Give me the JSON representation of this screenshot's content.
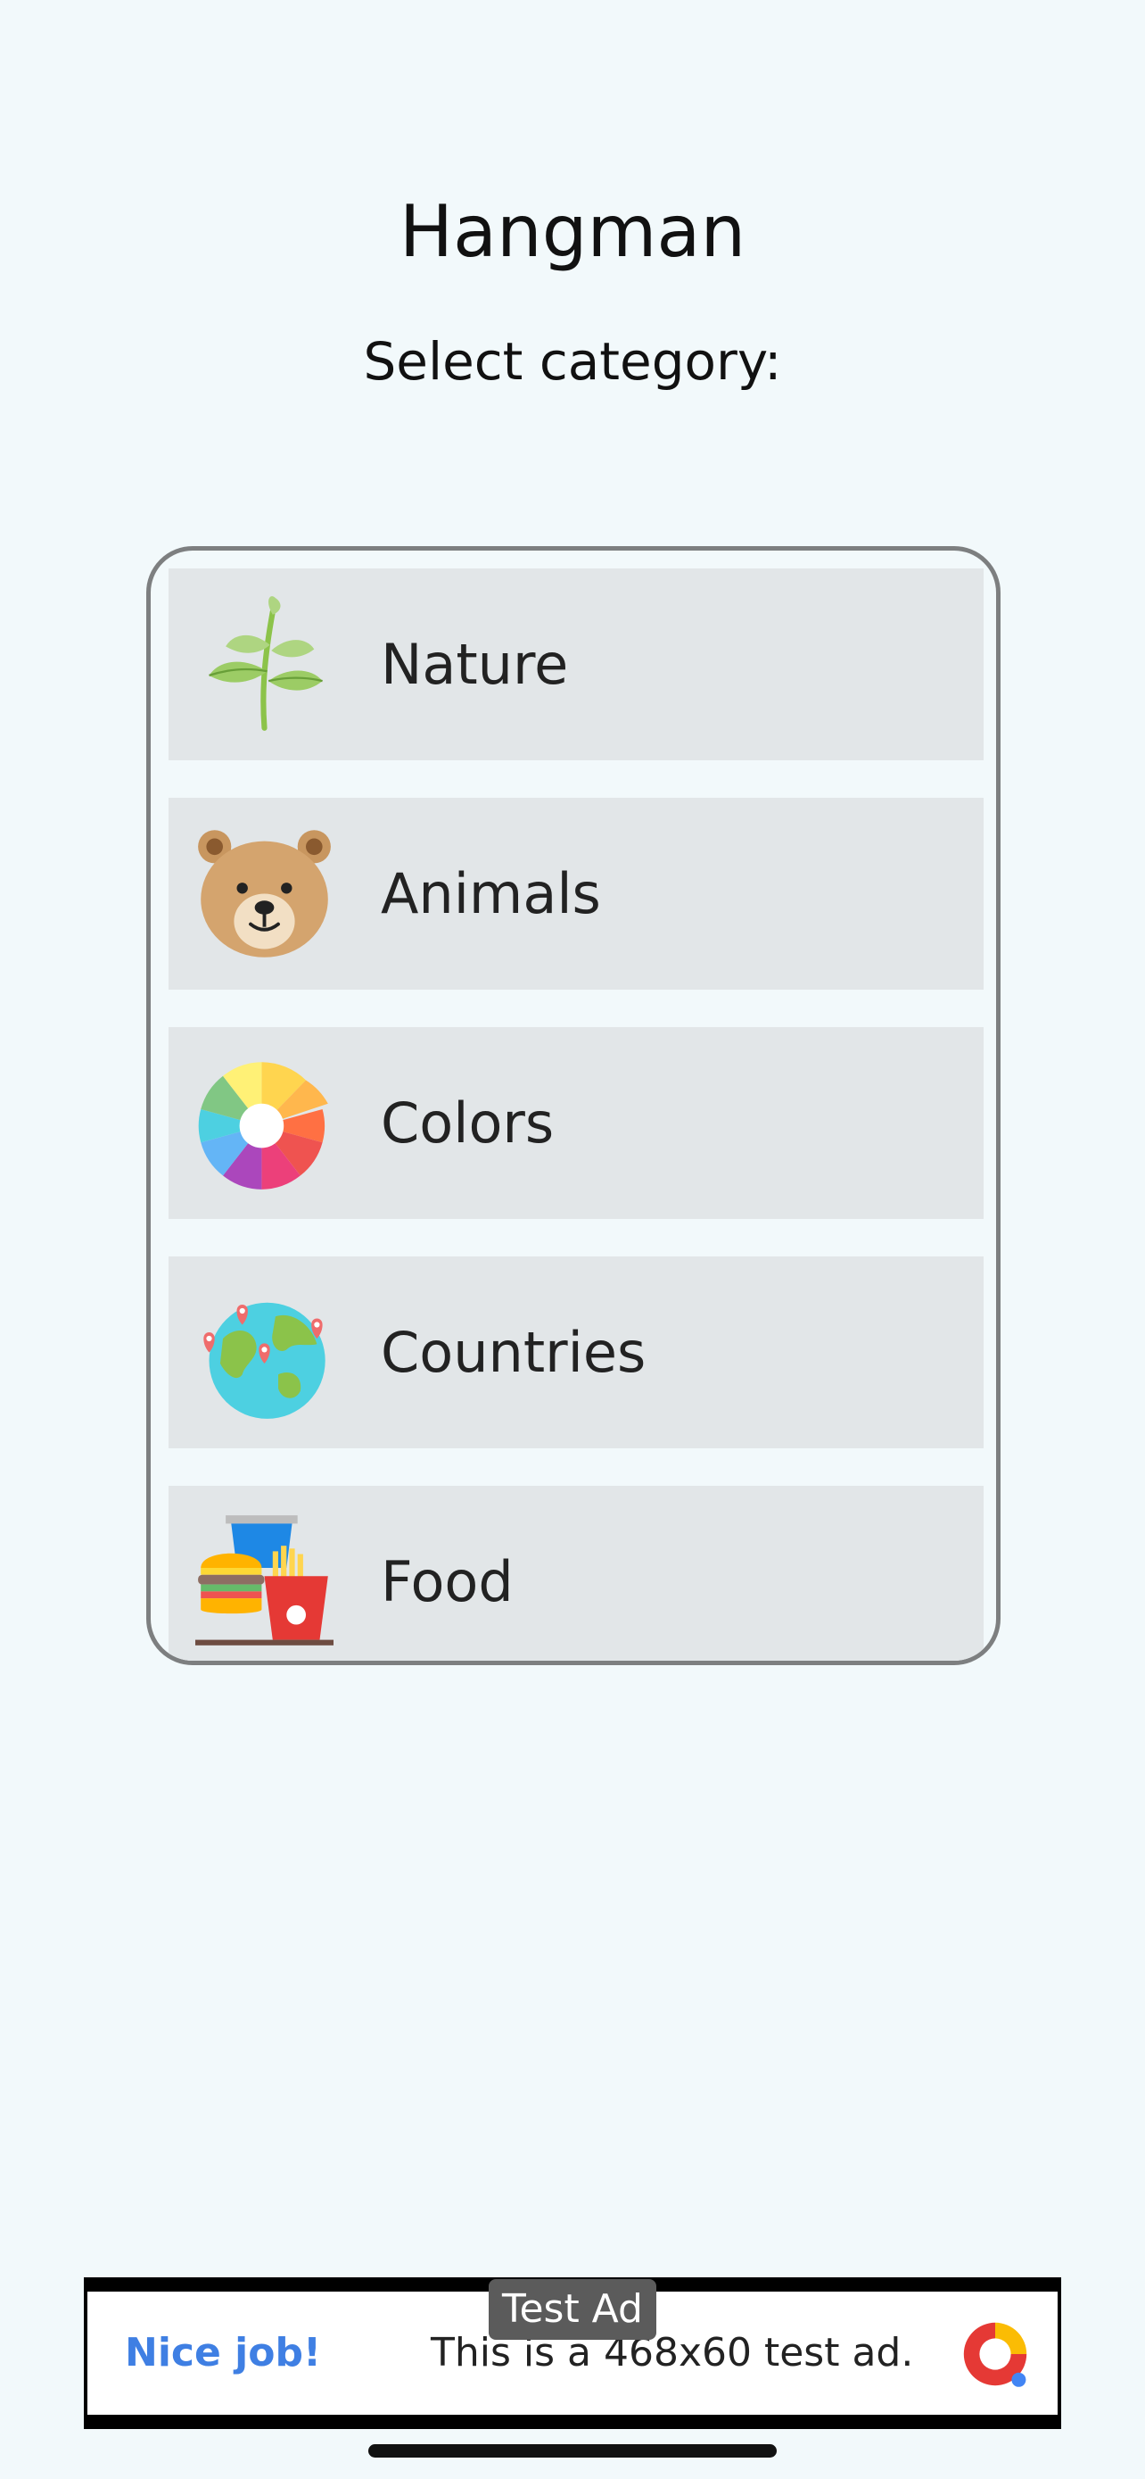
{
  "app": {
    "title": "Hangman",
    "subtitle": "Select category:"
  },
  "categories": [
    {
      "label": "Nature",
      "icon": "plant-sprout-icon"
    },
    {
      "label": "Animals",
      "icon": "bear-face-icon"
    },
    {
      "label": "Colors",
      "icon": "color-wheel-icon"
    },
    {
      "label": "Countries",
      "icon": "globe-pins-icon"
    },
    {
      "label": "Food",
      "icon": "burger-fries-drink-icon"
    }
  ],
  "ad": {
    "label": "Test Ad",
    "cta": "Nice job!",
    "text": "This is a 468x60 test ad.",
    "icon": "ad-logo-icon"
  },
  "colors": {
    "background": "#f2f9fb",
    "item_background": "#e2e6e8",
    "panel_border": "#7d7f80",
    "ad_cta": "#3f7fe3"
  }
}
